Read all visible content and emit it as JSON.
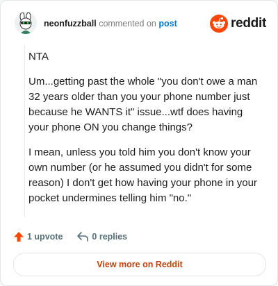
{
  "comment": {
    "username": "neonfuzzball",
    "action_text": "commented on",
    "post_link_label": "post",
    "paragraphs": [
      "NTA",
      "Um...getting past the whole \"you don't owe a man 32 years older than you your phone number just because he WANTS it\" issue...wtf does having your phone ON you change things?",
      "I mean, unless you told him you don't know your own number (or he assumed you didn't for some reason) I don't get how having your phone in your pocket undermines telling him \"no.\""
    ]
  },
  "brand": {
    "name": "reddit",
    "color": "#ff4500"
  },
  "actions": {
    "upvote_label": "1 upvote",
    "replies_label": "0 replies"
  },
  "footer": {
    "view_more_label": "View more on Reddit"
  },
  "colors": {
    "upvote_arrow": "#ff4500",
    "link_blue": "#0079d3",
    "view_more_text": "#c2410c"
  },
  "icons": {
    "avatar": "bunny-avatar-icon",
    "logo": "reddit-snoo-icon",
    "upvote": "upvote-arrow-icon",
    "reply": "reply-arrow-icon"
  }
}
